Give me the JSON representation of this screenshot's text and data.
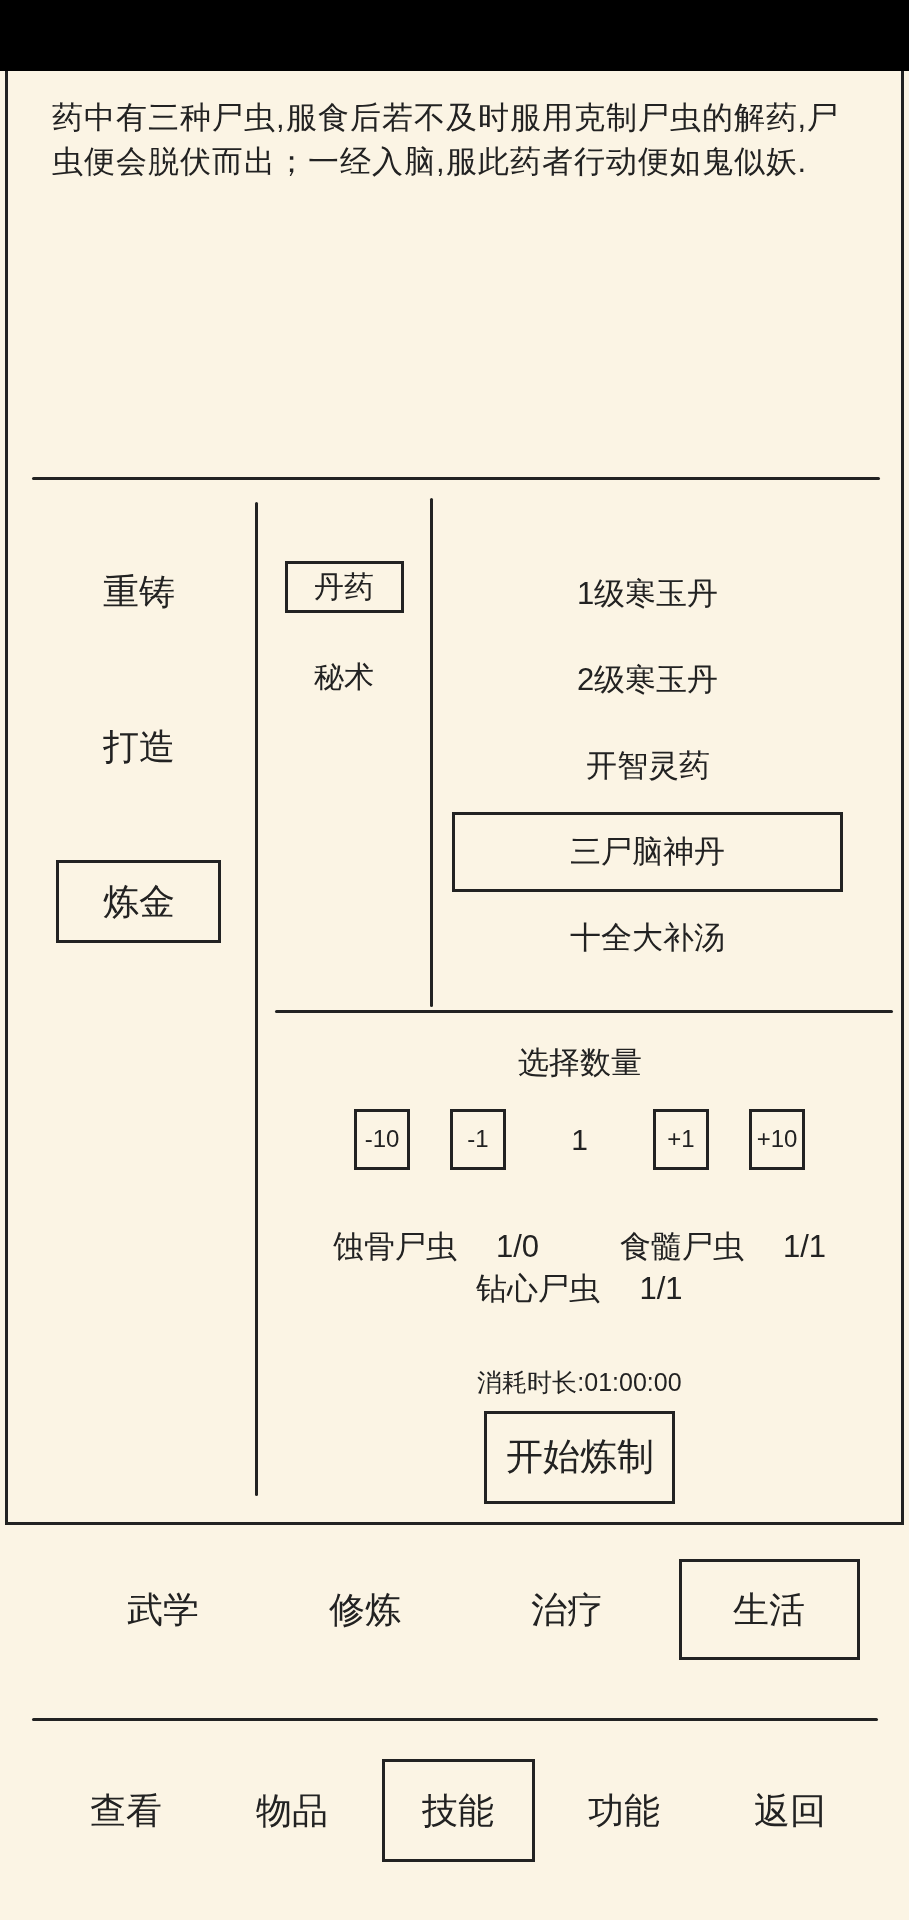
{
  "description": "药中有三种尸虫,服食后若不及时服用克制尸虫的解药,尸虫便会脱伏而出；一经入脑,服此药者行动便如鬼似妖.",
  "categories": [
    {
      "label": "重铸",
      "selected": false
    },
    {
      "label": "打造",
      "selected": false
    },
    {
      "label": "炼金",
      "selected": true
    }
  ],
  "subcategories": [
    {
      "label": "丹药",
      "selected": true
    },
    {
      "label": "秘术",
      "selected": false
    }
  ],
  "recipes": [
    {
      "label": "1级寒玉丹",
      "selected": false
    },
    {
      "label": "2级寒玉丹",
      "selected": false
    },
    {
      "label": "开智灵药",
      "selected": false
    },
    {
      "label": "三尸脑神丹",
      "selected": true
    },
    {
      "label": "十全大补汤",
      "selected": false
    }
  ],
  "quantity": {
    "title": "选择数量",
    "controls": [
      {
        "kind": "button",
        "label": "-10"
      },
      {
        "kind": "button",
        "label": "-1"
      },
      {
        "kind": "value",
        "label": "1"
      },
      {
        "kind": "button",
        "label": "+1"
      },
      {
        "kind": "button",
        "label": "+10"
      }
    ]
  },
  "materials": [
    {
      "name": "蚀骨尸虫",
      "count": "1/0"
    },
    {
      "name": "食髓尸虫",
      "count": "1/1"
    },
    {
      "name": "钻心尸虫",
      "count": "1/1"
    }
  ],
  "duration": "消耗时长:01:00:00",
  "start_button": "开始炼制",
  "skill_tabs": [
    {
      "label": "武学",
      "selected": false
    },
    {
      "label": "修炼",
      "selected": false
    },
    {
      "label": "治疗",
      "selected": false
    },
    {
      "label": "生活",
      "selected": true
    }
  ],
  "nav_tabs": [
    {
      "label": "查看",
      "selected": false
    },
    {
      "label": "物品",
      "selected": false
    },
    {
      "label": "技能",
      "selected": true
    },
    {
      "label": "功能",
      "selected": false
    },
    {
      "label": "返回",
      "selected": false
    }
  ]
}
